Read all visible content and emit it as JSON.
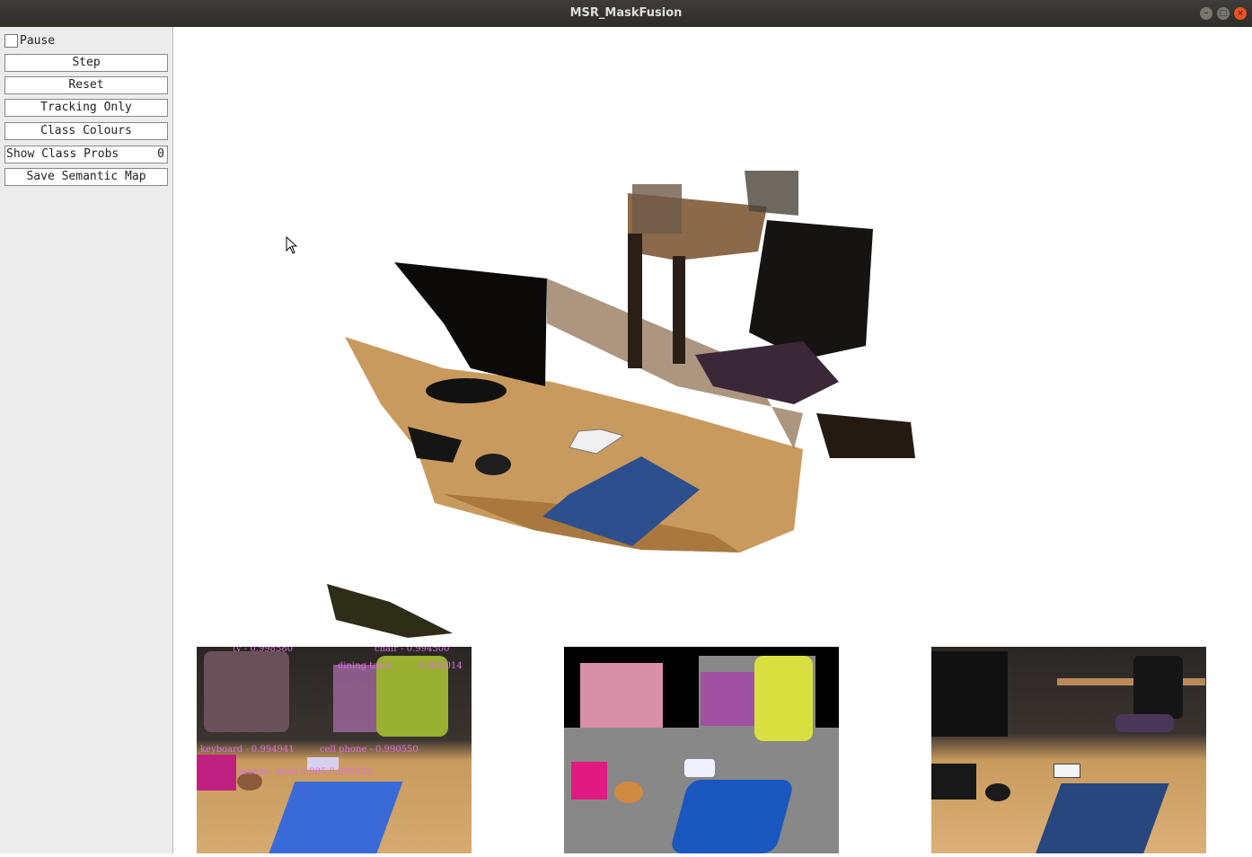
{
  "window": {
    "title": "MSR_MaskFusion"
  },
  "panel": {
    "pause": {
      "label": "Pause",
      "checked": false
    },
    "buttons": {
      "step": "Step",
      "reset": "Reset",
      "tracking_only": "Tracking Only",
      "class_colours": "Class Colours",
      "save_semantic_map": "Save Semantic Map"
    },
    "show_class_probs": {
      "label": "Show Class Probs",
      "value": "0"
    }
  },
  "detections": {
    "tv": "tv - 0.998580",
    "chair": "chair - 0.994500",
    "dining_table": "dining table",
    "dining_table_score": "0.802014",
    "keyboard": "keyboard - 0.994941",
    "cell_phone": "cell phone - 0.990550",
    "mouse": "mouse",
    "book": "book 0.985 0.995520"
  },
  "colors": {
    "titlebar": "#2e2d2a",
    "close": "#e9541f",
    "label": "#e070e0"
  }
}
